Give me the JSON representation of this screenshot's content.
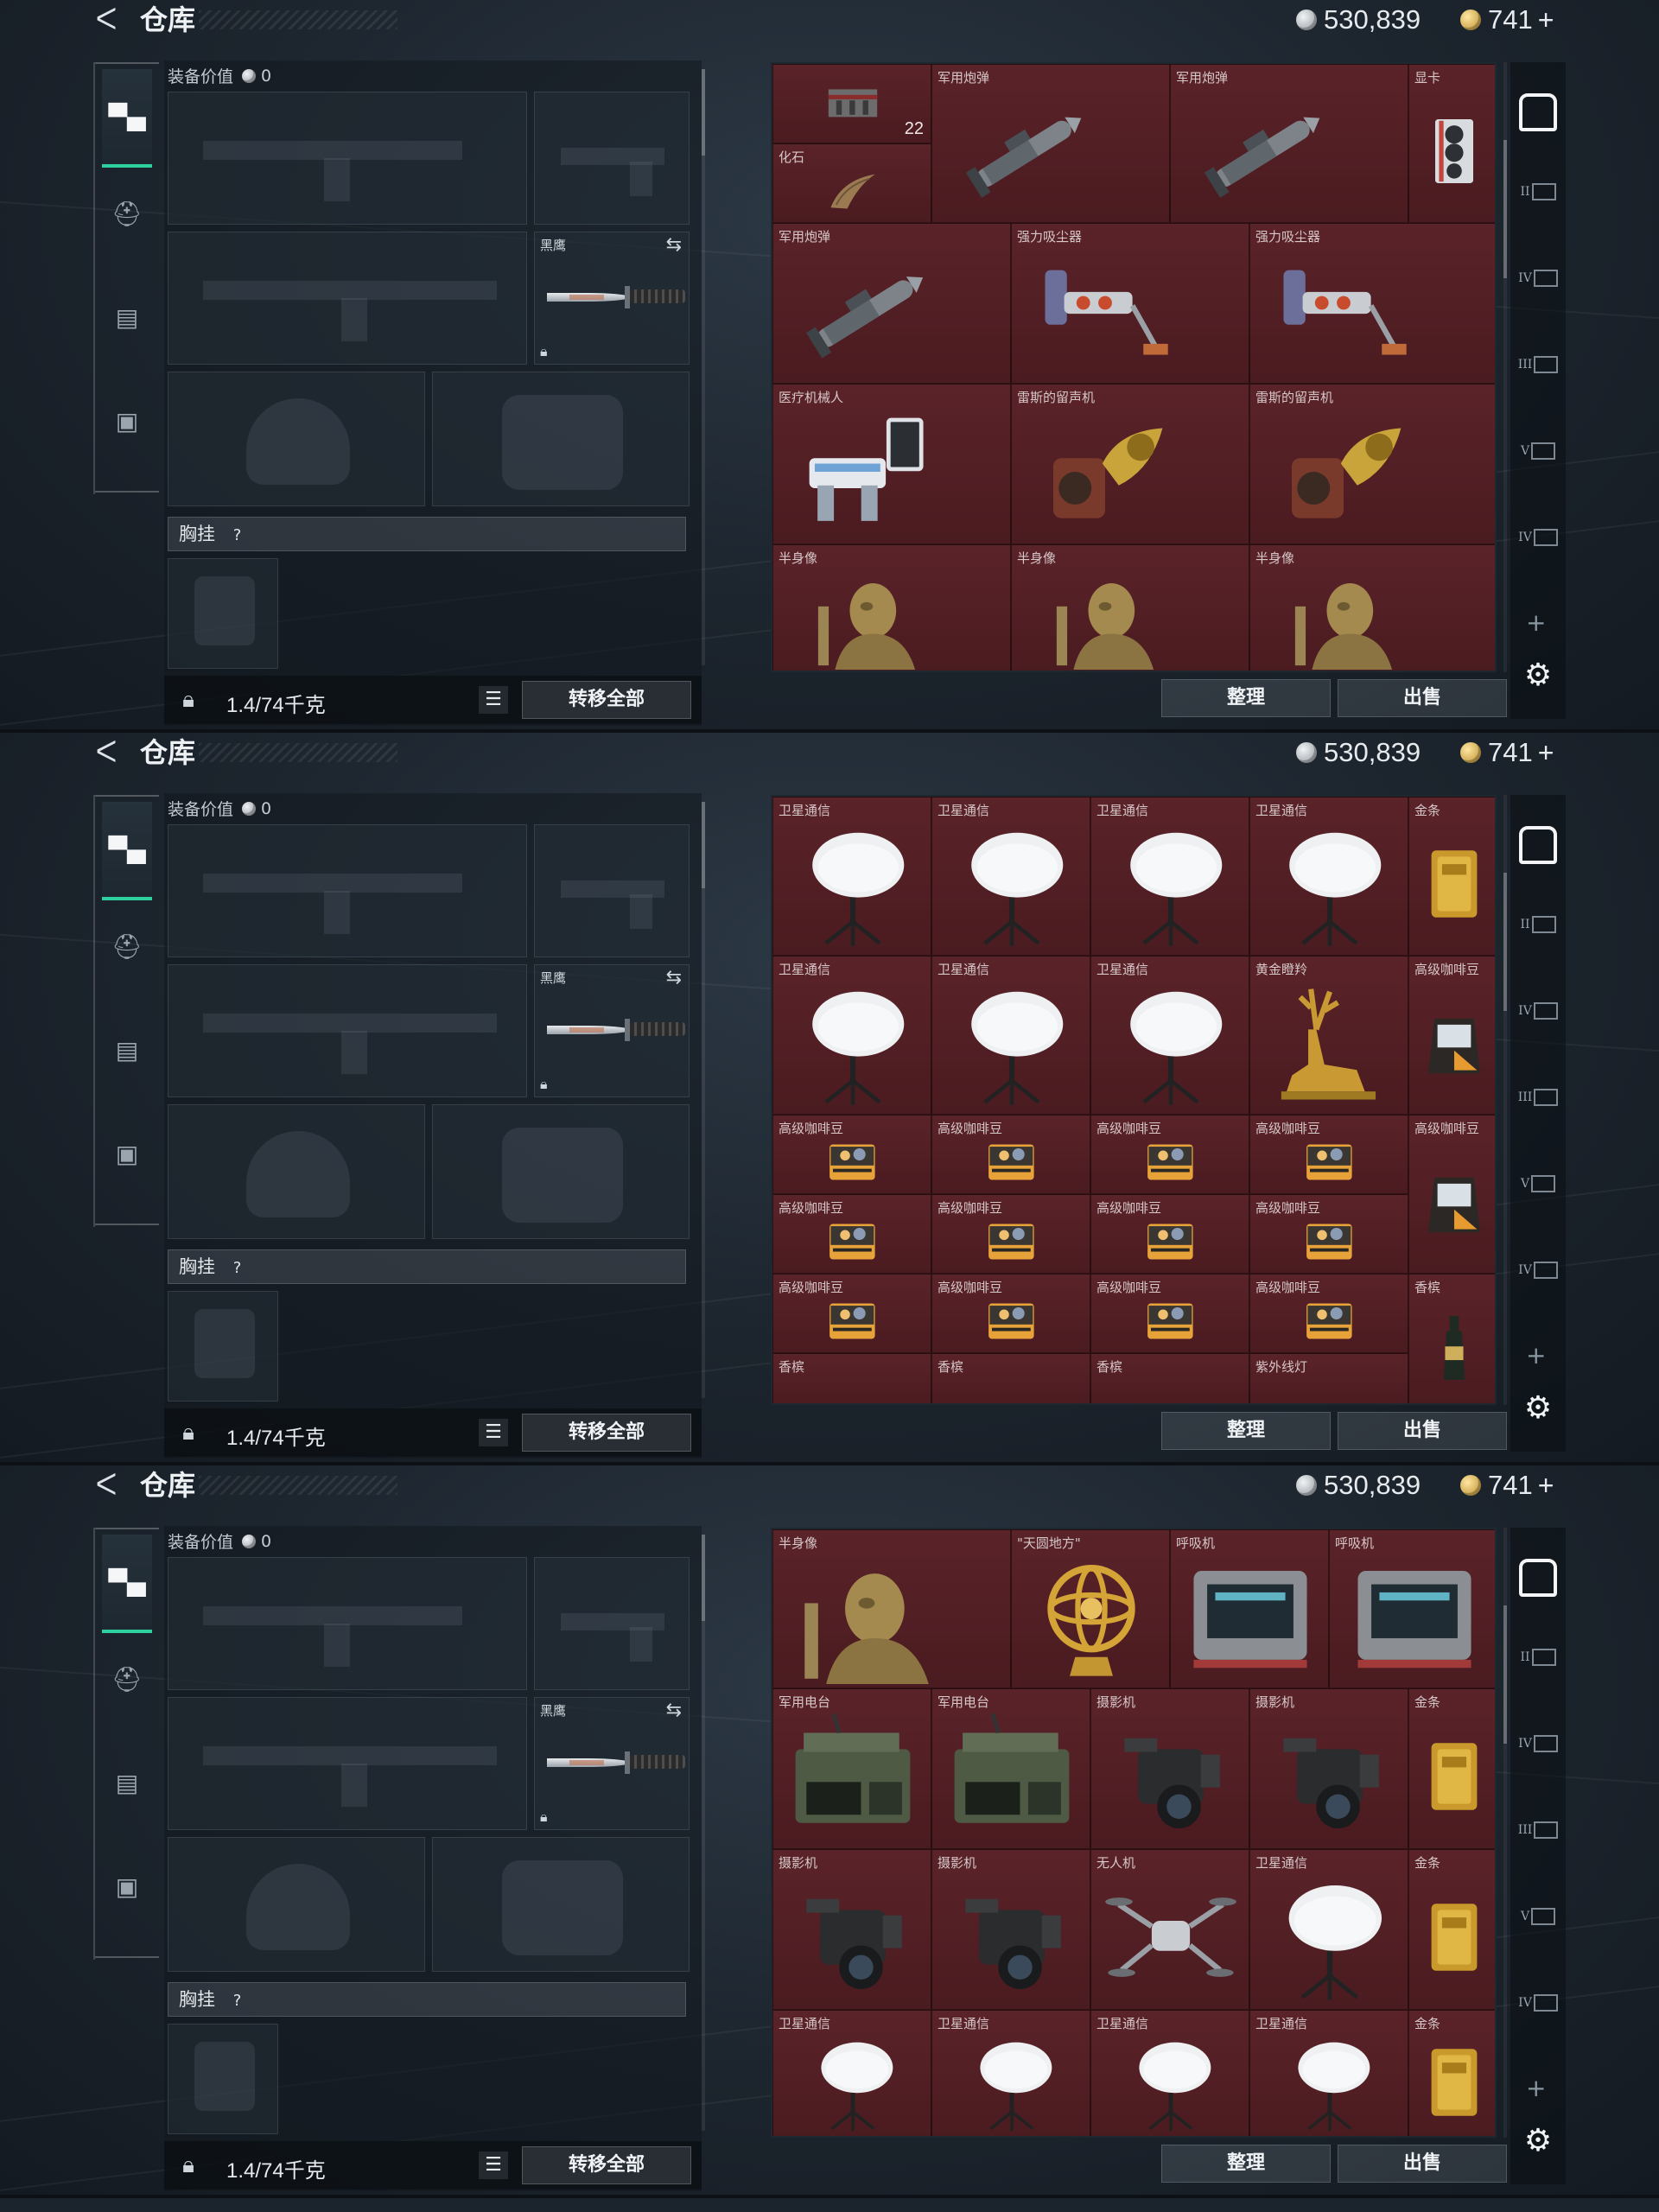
{
  "topbar": {
    "back_glyph": "ᐸ",
    "title": "仓库",
    "silver": "530,839",
    "gold": "741",
    "gold_plus": "+"
  },
  "equip": {
    "value_label": "装备价值",
    "value": "0",
    "knife_name": "黑鹰",
    "chest_label": "胸挂",
    "chest_hint": "?",
    "weight": "1.4/74千克",
    "transfer_all": "转移全部"
  },
  "storage_actions": {
    "sort": "整理",
    "sell": "出售"
  },
  "right_tabs": {
    "home_icon": "home-icon",
    "labels": [
      "II",
      "IV",
      "III",
      "V",
      "IV"
    ],
    "plus": "+",
    "settings_icon": "gear-icon"
  },
  "screens": [
    {
      "cells": [
        {
          "name": "",
          "count": "22",
          "art": "case"
        },
        {
          "name": "军用炮弹",
          "art": "shell"
        },
        {
          "name": "军用炮弹",
          "art": "shell"
        },
        {
          "name": "显卡",
          "art": "gpu"
        },
        {
          "name": "化石",
          "art": "fossil"
        },
        {
          "name": "军用炮弹",
          "art": "shell"
        },
        {
          "name": "强力吸尘器",
          "art": "vacuum"
        },
        {
          "name": "强力吸尘器",
          "art": "vacuum"
        },
        {
          "name": "医疗机械人",
          "art": "robot"
        },
        {
          "name": "雷斯的留声机",
          "art": "gramophone"
        },
        {
          "name": "雷斯的留声机",
          "art": "gramophone"
        },
        {
          "name": "半身像",
          "art": "bust"
        },
        {
          "name": "半身像",
          "art": "bust"
        },
        {
          "name": "半身像",
          "art": "bust"
        }
      ]
    },
    {
      "cells": [
        {
          "name": "卫星通信",
          "art": "dish"
        },
        {
          "name": "卫星通信",
          "art": "dish"
        },
        {
          "name": "卫星通信",
          "art": "dish"
        },
        {
          "name": "卫星通信",
          "art": "dish"
        },
        {
          "name": "金条",
          "art": "goldbar"
        },
        {
          "name": "卫星通信",
          "art": "dish"
        },
        {
          "name": "卫星通信",
          "art": "dish"
        },
        {
          "name": "卫星通信",
          "art": "dish"
        },
        {
          "name": "黄金瞪羚",
          "art": "gazelle"
        },
        {
          "name": "高级咖啡豆",
          "art": "coffeebag"
        },
        {
          "name": "高级咖啡豆",
          "art": "coffee"
        },
        {
          "name": "高级咖啡豆",
          "art": "coffee"
        },
        {
          "name": "高级咖啡豆",
          "art": "coffee"
        },
        {
          "name": "高级咖啡豆",
          "art": "coffee"
        },
        {
          "name": "高级咖啡豆",
          "art": "coffeebag"
        },
        {
          "name": "高级咖啡豆",
          "art": "coffee"
        },
        {
          "name": "高级咖啡豆",
          "art": "coffee"
        },
        {
          "name": "高级咖啡豆",
          "art": "coffee"
        },
        {
          "name": "高级咖啡豆",
          "art": "coffee"
        },
        {
          "name": "高级咖啡豆",
          "art": "coffee"
        },
        {
          "name": "高级咖啡豆",
          "art": "coffee"
        },
        {
          "name": "高级咖啡豆",
          "art": "coffee"
        },
        {
          "name": "高级咖啡豆",
          "art": "coffee"
        },
        {
          "name": "香槟",
          "art": "champagne"
        },
        {
          "name": "香槟",
          "art": "none"
        },
        {
          "name": "香槟",
          "art": "none"
        },
        {
          "name": "香槟",
          "art": "none"
        },
        {
          "name": "紫外线灯",
          "art": "none"
        }
      ]
    },
    {
      "cells": [
        {
          "name": "半身像",
          "art": "bust"
        },
        {
          "name": "\"天圆地方\"",
          "art": "globe"
        },
        {
          "name": "呼吸机",
          "art": "ventilator"
        },
        {
          "name": "呼吸机",
          "art": "ventilator"
        },
        {
          "name": "军用电台",
          "art": "radio"
        },
        {
          "name": "军用电台",
          "art": "radio"
        },
        {
          "name": "摄影机",
          "art": "camera"
        },
        {
          "name": "摄影机",
          "art": "camera"
        },
        {
          "name": "金条",
          "art": "goldbar"
        },
        {
          "name": "摄影机",
          "art": "camera"
        },
        {
          "name": "摄影机",
          "art": "camera"
        },
        {
          "name": "无人机",
          "art": "drone"
        },
        {
          "name": "卫星通信",
          "art": "dish"
        },
        {
          "name": "金条",
          "art": "goldbar"
        },
        {
          "name": "卫星通信",
          "art": "dish"
        },
        {
          "name": "卫星通信",
          "art": "dish"
        },
        {
          "name": "卫星通信",
          "art": "dish"
        },
        {
          "name": "卫星通信",
          "art": "dish"
        },
        {
          "name": "金条",
          "art": "goldbar"
        }
      ]
    }
  ]
}
